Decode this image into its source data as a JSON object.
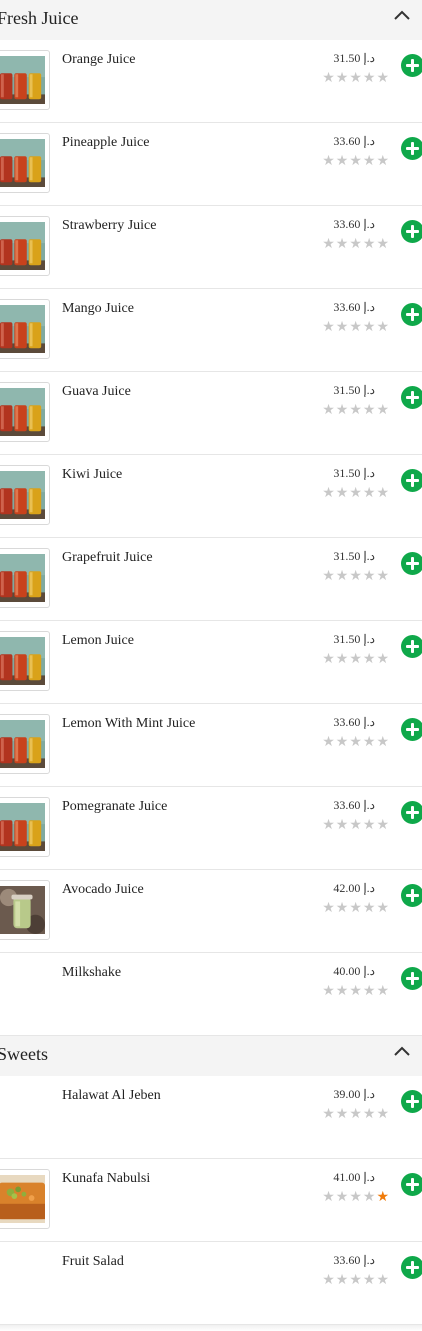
{
  "sections": [
    {
      "title": "Fresh Juice",
      "toggle_icon": "chevron-up-icon",
      "items": [
        {
          "name": "Orange Juice",
          "price": "31.50 د.إ",
          "rating": 0,
          "image": "juice-glasses"
        },
        {
          "name": "Pineapple Juice",
          "price": "33.60 د.إ",
          "rating": 0,
          "image": "juice-glasses"
        },
        {
          "name": "Strawberry Juice",
          "price": "33.60 د.إ",
          "rating": 0,
          "image": "juice-glasses"
        },
        {
          "name": "Mango Juice",
          "price": "33.60 د.إ",
          "rating": 0,
          "image": "juice-glasses"
        },
        {
          "name": "Guava Juice",
          "price": "31.50 د.إ",
          "rating": 0,
          "image": "juice-glasses"
        },
        {
          "name": "Kiwi Juice",
          "price": "31.50 د.إ",
          "rating": 0,
          "image": "juice-glasses"
        },
        {
          "name": "Grapefruit Juice",
          "price": "31.50 د.إ",
          "rating": 0,
          "image": "juice-glasses"
        },
        {
          "name": "Lemon Juice",
          "price": "31.50 د.إ",
          "rating": 0,
          "image": "juice-glasses"
        },
        {
          "name": "Lemon With Mint Juice",
          "price": "33.60 د.إ",
          "rating": 0,
          "image": "juice-glasses"
        },
        {
          "name": "Pomegranate Juice",
          "price": "33.60 د.إ",
          "rating": 0,
          "image": "juice-glasses"
        },
        {
          "name": "Avocado Juice",
          "price": "42.00 د.إ",
          "rating": 0,
          "image": "avocado-glass"
        },
        {
          "name": "Milkshake",
          "price": "40.00 د.إ",
          "rating": 0,
          "image": null
        }
      ]
    },
    {
      "title": "Sweets",
      "toggle_icon": "chevron-up-icon",
      "items": [
        {
          "name": "Halawat Al Jeben",
          "price": "39.00 د.إ",
          "rating": 0,
          "image": null
        },
        {
          "name": "Kunafa Nabulsi",
          "price": "41.00 د.إ",
          "rating": 1,
          "image": "kunafa"
        },
        {
          "name": "Fruit Salad",
          "price": "33.60 د.إ",
          "rating": 0,
          "image": null
        }
      ]
    }
  ],
  "stars_max": 5,
  "colors": {
    "add_button": "#0fa84a",
    "star_empty": "#c8c8c8",
    "star_filled": "#f07b0a",
    "section_header_bg": "#f4f4f4"
  }
}
